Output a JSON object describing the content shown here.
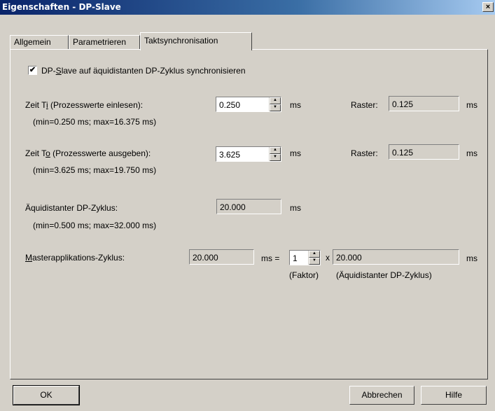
{
  "window": {
    "title": "Eigenschaften - DP-Slave",
    "close_label": "×"
  },
  "tabs": [
    {
      "label": "Allgemein",
      "active": false
    },
    {
      "label": "Parametrieren",
      "active": false
    },
    {
      "label": "Taktsynchronisation",
      "active": true
    }
  ],
  "sync_checkbox": {
    "checked": true,
    "mark": "✔",
    "label_pre": "DP-",
    "label_mnemonic": "S",
    "label_post": "lave auf äquidistanten DP-Zyklus synchronisieren"
  },
  "ti": {
    "label_pre": "Zeit T",
    "label_mnemonic": "i",
    "label_post": " (Prozesswerte einlesen):",
    "range": "(min=0.250 ms; max=16.375 ms)",
    "value": "0.250",
    "unit": "ms",
    "raster_label": "Raster:",
    "raster_value": "0.125",
    "raster_unit": "ms"
  },
  "to": {
    "label_pre": "Zeit T",
    "label_mnemonic": "o",
    "label_post": " (Prozesswerte ausgeben):",
    "range": "(min=3.625 ms; max=19.750 ms)",
    "value": "3.625",
    "unit": "ms",
    "raster_label": "Raster:",
    "raster_value": "0.125",
    "raster_unit": "ms"
  },
  "dp_cycle": {
    "label": "Äquidistanter DP-Zyklus:",
    "range": "(min=0.500 ms; max=32.000 ms)",
    "value": "20.000",
    "unit": "ms"
  },
  "master_cycle": {
    "label_mnemonic": "M",
    "label_post": "asterapplikations-Zyklus:",
    "value": "20.000",
    "unit_eq": "ms =",
    "factor_value": "1",
    "times": "x",
    "dp_value": "20.000",
    "dp_unit": "ms",
    "factor_caption": "(Faktor)",
    "dp_caption": "(Äquidistanter DP-Zyklus)"
  },
  "buttons": {
    "ok": "OK",
    "cancel": "Abbrechen",
    "help": "Hilfe"
  }
}
